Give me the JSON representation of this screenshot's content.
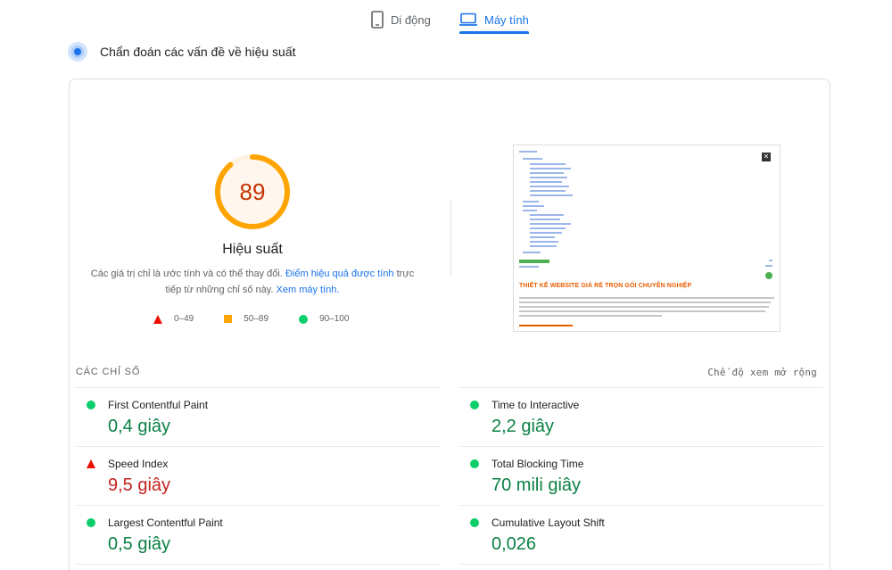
{
  "tabs": {
    "mobile_label": "Di động",
    "desktop_label": "Máy tính"
  },
  "section": {
    "title": "Chẩn đoán các vấn đề về hiệu suất"
  },
  "performance": {
    "score": "89",
    "title": "Hiệu suất",
    "desc_prefix": "Các giá trị chỉ là ước tính và có thể thay đổi. ",
    "desc_link": "Điểm hiệu quả được tính",
    "desc_middle": " trực tiếp từ những chỉ số này. ",
    "desc_link2": "Xem máy tính.",
    "score_fraction": 0.89,
    "gauge_color": "#ffa400",
    "score_color": "#c33300"
  },
  "legend": [
    {
      "range": "0–49",
      "shape": "triangle",
      "color": "#eb0f00"
    },
    {
      "range": "50–89",
      "shape": "square",
      "color": "#ffa400"
    },
    {
      "range": "90–100",
      "shape": "circle",
      "color": "#0cce6b"
    }
  ],
  "thumbnail": {
    "headline": "THIẾT KẾ WEBSITE GIÁ RẺ TRỌN GÓI CHUYÊN NGHIỆP"
  },
  "metrics": {
    "heading": "CÁC CHỈ SỐ",
    "expand_label": "Chế độ xem mở rộng",
    "items": [
      {
        "label": "First Contentful Paint",
        "value": "0,4 giây",
        "status": "good"
      },
      {
        "label": "Time to Interactive",
        "value": "2,2 giây",
        "status": "good"
      },
      {
        "label": "Speed Index",
        "value": "9,5 giây",
        "status": "poor"
      },
      {
        "label": "Total Blocking Time",
        "value": "70 mili giây",
        "status": "good"
      },
      {
        "label": "Largest Contentful Paint",
        "value": "0,5 giây",
        "status": "good"
      },
      {
        "label": "Cumulative Layout Shift",
        "value": "0,026",
        "status": "good"
      }
    ]
  }
}
